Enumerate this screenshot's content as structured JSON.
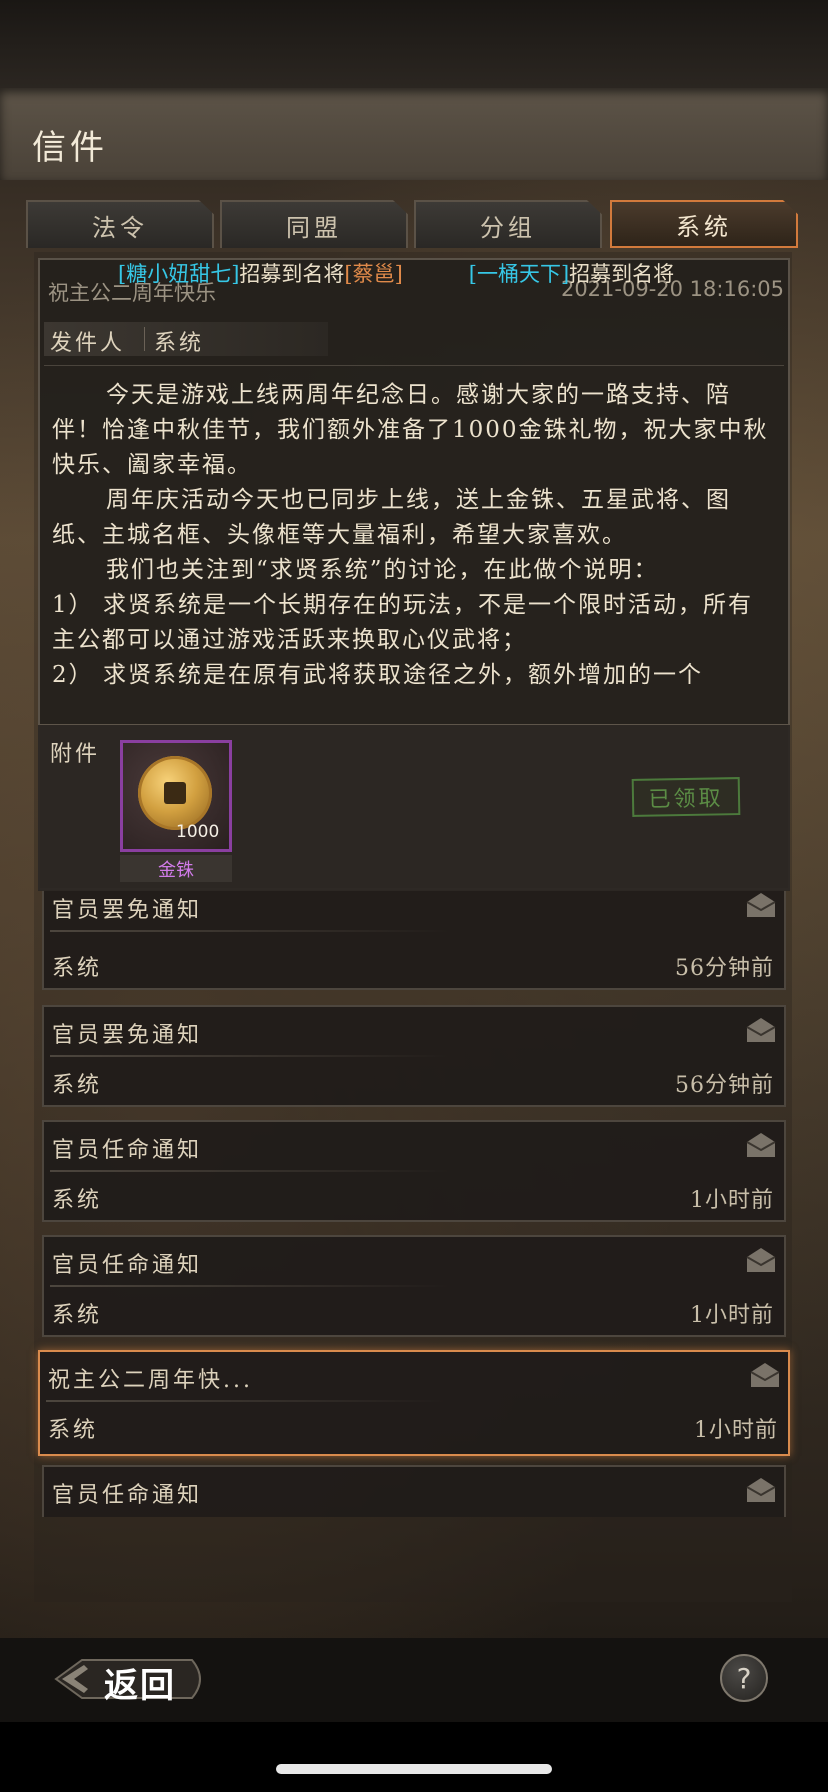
{
  "window": {
    "title": "信件"
  },
  "tabs": [
    {
      "label": "法令",
      "active": false
    },
    {
      "label": "同盟",
      "active": false
    },
    {
      "label": "分组",
      "active": false
    },
    {
      "label": "系统",
      "active": true
    }
  ],
  "ticker": {
    "msg1_player": "[糖小妞甜七]",
    "msg1_text": "招募到名将",
    "msg1_general": "[蔡邕]",
    "msg2_player": "[一桶天下]",
    "msg2_text": "招募到名将"
  },
  "detail": {
    "subject": "祝主公二周年快乐",
    "time": "2021-09-20 18:16:05",
    "sender_label": "发件人",
    "sender": "系统",
    "paragraphs": [
      "今天是游戏上线两周年纪念日。感谢大家的一路支持、陪伴！恰逢中秋佳节，我们额外准备了1000金铢礼物，祝大家中秋快乐、阖家幸福。",
      "周年庆活动今天也已同步上线，送上金铢、五星武将、图纸、主城名框、头像框等大量福利，希望大家喜欢。",
      "我们也关注到“求贤系统”的讨论，在此做个说明：",
      "1） 求贤系统是一个长期存在的玩法，不是一个限时活动，所有主公都可以通过游戏活跃来换取心仪武将；",
      "2） 求贤系统是在原有武将获取途径之外，额外增加的一个"
    ],
    "attachment_label": "附件",
    "attachment": {
      "name": "金铢",
      "count": "1000",
      "icon": "gold-coin-icon"
    },
    "claimed_label": "已领取"
  },
  "mail_list": [
    {
      "subject": "官员罢免通知",
      "sender": "系统",
      "time": "56分钟前",
      "read": true
    },
    {
      "subject": "官员罢免通知",
      "sender": "系统",
      "time": "56分钟前",
      "read": true
    },
    {
      "subject": "官员任命通知",
      "sender": "系统",
      "time": "1小时前",
      "read": true
    },
    {
      "subject": "官员任命通知",
      "sender": "系统",
      "time": "1小时前",
      "read": true
    },
    {
      "subject": "祝主公二周年快...",
      "sender": "系统",
      "time": "1小时前",
      "read": true,
      "selected": true
    },
    {
      "subject": "官员任命通知",
      "sender": "",
      "time": "",
      "read": true
    }
  ],
  "footer": {
    "back_label": "返回",
    "help_label": "?"
  },
  "colors": {
    "accent": "#d98b4d",
    "player_name": "#36c7e6",
    "general_name": "#e08a4a",
    "item_purple": "#d07be8",
    "claimed_green": "#5b8c45"
  }
}
